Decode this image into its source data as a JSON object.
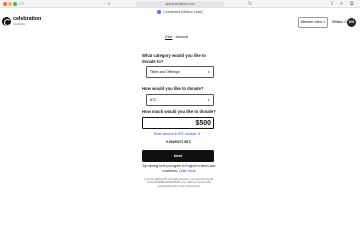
{
  "browser": {
    "url": "app.securityhtm.com",
    "connection_status": "Connected (Motion Lidar)"
  },
  "header": {
    "logo_main": "celebration",
    "logo_sub": "CHURCH",
    "member_view_label": "Member View",
    "user_name": "William G",
    "avatar_initials": "WG"
  },
  "breadcrumb": {
    "give_label": "Give",
    "current_label": "Amount"
  },
  "form": {
    "category_question": "What category would you like to donate to?",
    "category_value": "Tithes and Offerings",
    "currency_question": "How would you like to donate?",
    "currency_value": "BTC",
    "amount_question": "How much would you like to donate?",
    "amount_value": "$500",
    "btc_link": "Enter amount in BTC instead",
    "btc_estimate": "0.00490271 BTC",
    "next_label": "Next",
    "terms_text": "By clicking next you agree to Engiven's terms and conditions.",
    "learn_more": "Learn More",
    "fine_print": "If you are gifting PYP or an ERC-20 token, you must send the gift via the ETHEREUM NETWORK only. Gifts sent via any other network will result in loss of those funds."
  }
}
